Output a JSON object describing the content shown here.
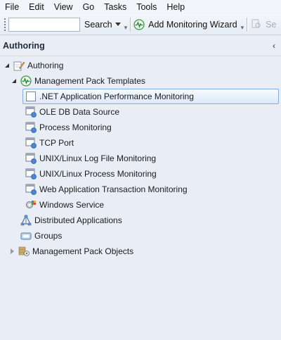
{
  "menu": [
    "File",
    "Edit",
    "View",
    "Go",
    "Tasks",
    "Tools",
    "Help"
  ],
  "toolbar": {
    "search_value": "",
    "search_label": "Search",
    "add_wizard_label": "Add Monitoring Wizard",
    "truncated_label": "Se"
  },
  "pane": {
    "title": "Authoring",
    "collapse_glyph": "‹"
  },
  "tree": {
    "root": "Authoring",
    "mp_templates": "Management Pack Templates",
    "templates": [
      ".NET Application Performance Monitoring",
      "OLE DB Data Source",
      "Process Monitoring",
      "TCP Port",
      "UNIX/Linux Log File Monitoring",
      "UNIX/Linux Process Monitoring",
      "Web Application Transaction Monitoring",
      "Windows Service"
    ],
    "distributed_apps": "Distributed Applications",
    "groups": "Groups",
    "mp_objects": "Management Pack Objects"
  },
  "colors": {
    "accent": "#85aee0",
    "pane_bg": "#e9eef6",
    "monitor_green": "#2e9a3a"
  }
}
